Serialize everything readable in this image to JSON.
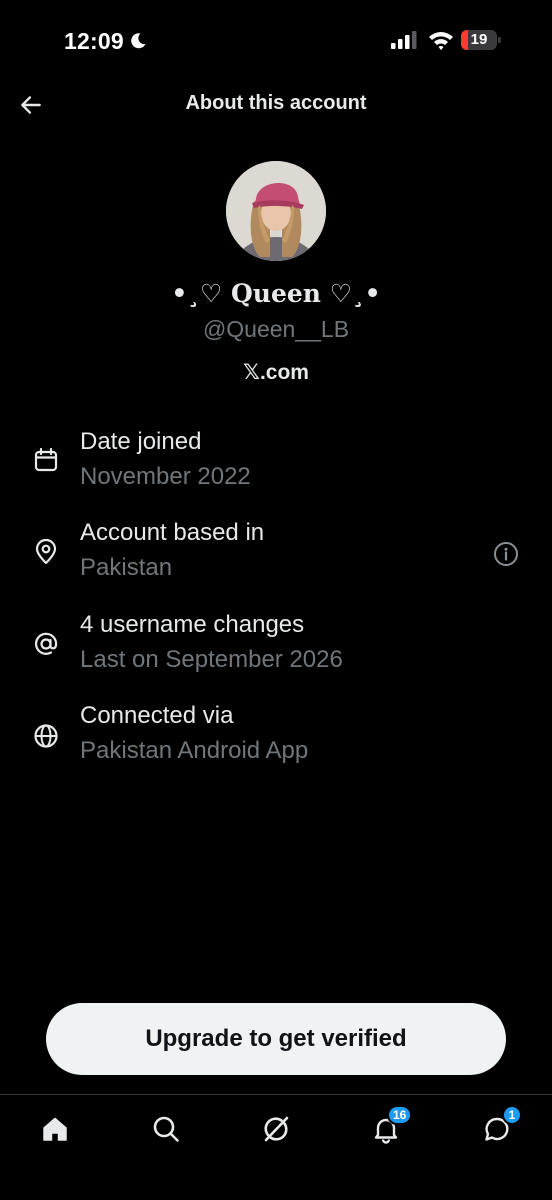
{
  "status_bar": {
    "time": "12:09",
    "battery_level": "19",
    "battery_fraction": 0.19,
    "icons": [
      "moon-icon",
      "signal-icon",
      "wifi-icon",
      "battery-icon"
    ]
  },
  "header": {
    "title": "About this account",
    "back_icon": "arrow-left-icon"
  },
  "profile": {
    "display_name": "•¸♡ Queen ♡¸•",
    "handle": "@Queen__LB",
    "site": "𝕏.com"
  },
  "info": [
    {
      "icon": "calendar-icon",
      "title": "Date joined",
      "subtitle": "November 2022"
    },
    {
      "icon": "location-pin-icon",
      "title": "Account based in",
      "subtitle": "Pakistan",
      "action_icon": "info-circle-icon"
    },
    {
      "icon": "at-sign-icon",
      "title": "4 username changes",
      "subtitle": "Last on September 2026"
    },
    {
      "icon": "globe-icon",
      "title": "Connected via",
      "subtitle": "Pakistan Android App"
    }
  ],
  "upgrade_button": {
    "label": "Upgrade to get verified"
  },
  "bottom_nav": {
    "items": [
      {
        "icon": "home-icon"
      },
      {
        "icon": "search-icon"
      },
      {
        "icon": "grok-icon"
      },
      {
        "icon": "bell-icon",
        "badge": "16"
      },
      {
        "icon": "chat-icon",
        "badge": "1"
      }
    ]
  },
  "colors": {
    "background": "#000000",
    "primary_text": "#e7e9ea",
    "secondary_text": "#71767b",
    "accent": "#1d9bf0",
    "button_bg": "#eff3f4",
    "battery_low": "#ff3b30"
  }
}
